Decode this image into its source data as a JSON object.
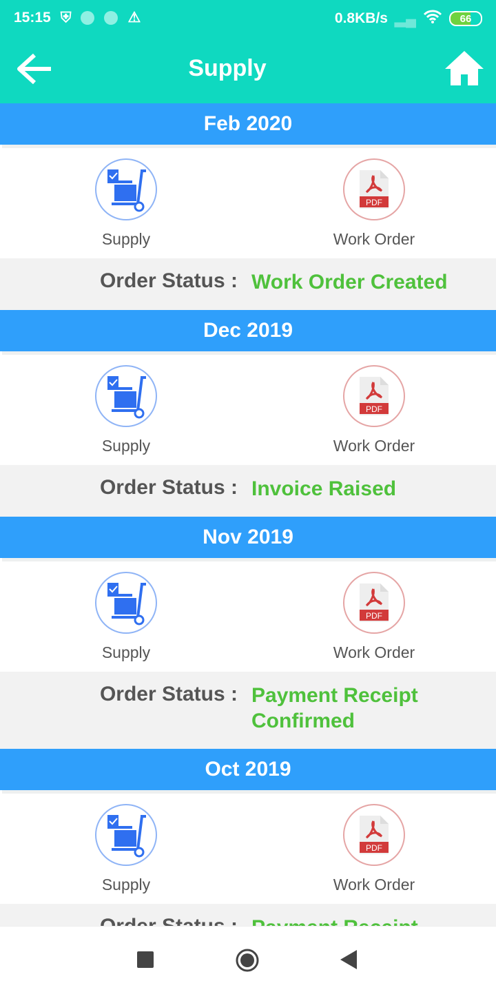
{
  "status_bar": {
    "time": "15:15",
    "net_speed": "0.8KB/s",
    "battery": "66"
  },
  "app_bar": {
    "title": "Supply",
    "back_icon": "arrow-left-icon",
    "home_icon": "home-icon"
  },
  "colors": {
    "app_bar": "#0fd9c0",
    "month_header": "#2f9ffb",
    "status_value": "#4fc13c"
  },
  "order_status_label": "Order Status :",
  "months": [
    {
      "month": "Feb 2020",
      "supply_label": "Supply",
      "work_order_label": "Work Order",
      "status": "Work Order Created"
    },
    {
      "month": "Dec 2019",
      "supply_label": "Supply",
      "work_order_label": "Work Order",
      "status": "Invoice Raised"
    },
    {
      "month": "Nov 2019",
      "supply_label": "Supply",
      "work_order_label": "Work Order",
      "status": "Payment Receipt Confirmed"
    },
    {
      "month": "Oct 2019",
      "supply_label": "Supply",
      "work_order_label": "Work Order",
      "status": "Payment Receipt"
    }
  ],
  "pdf_badge": "PDF"
}
